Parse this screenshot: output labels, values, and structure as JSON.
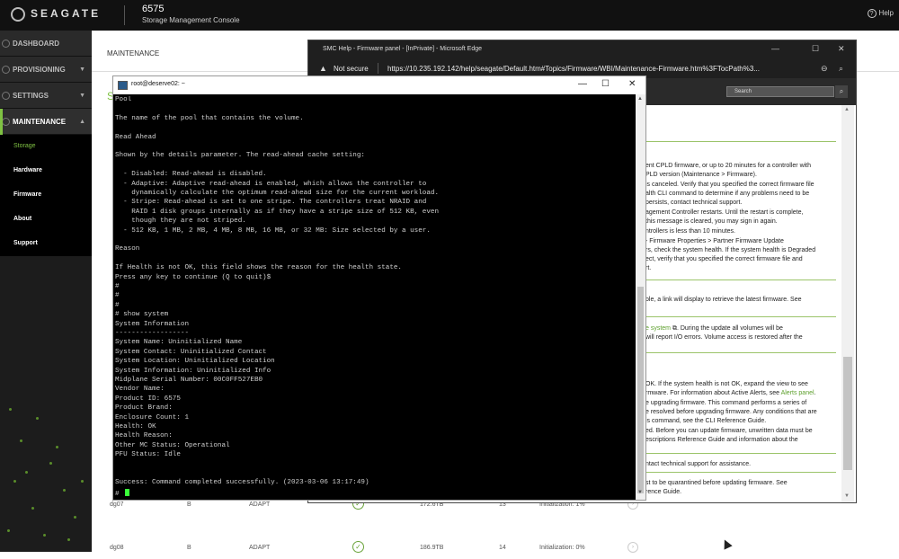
{
  "topbar": {
    "logo": "SEAGATE",
    "product": "6575",
    "subtitle": "Storage Management Console",
    "help": "Help"
  },
  "sidebar": {
    "items": [
      {
        "label": "DASHBOARD"
      },
      {
        "label": "PROVISIONING"
      },
      {
        "label": "SETTINGS"
      },
      {
        "label": "MAINTENANCE"
      }
    ],
    "subitems": [
      {
        "label": "Storage"
      },
      {
        "label": "Hardware"
      },
      {
        "label": "Firmware"
      },
      {
        "label": "About"
      },
      {
        "label": "Support"
      }
    ]
  },
  "main": {
    "title": "MAINTENANCE",
    "section_initial": "S",
    "rows": [
      {
        "name": "dg07",
        "owner": "B",
        "type": "ADAPT",
        "size": "172.6TB",
        "disks": "13",
        "status": "Initialization: 1%"
      },
      {
        "name": "dg08",
        "owner": "B",
        "type": "ADAPT",
        "size": "186.9TB",
        "disks": "14",
        "status": "Initialization: 0%"
      }
    ]
  },
  "edge": {
    "title": "SMC Help - Firmware panel - [InPrivate] - Microsoft Edge",
    "not_secure": "Not secure",
    "url": "https://10.235.192.142/help/seagate/Default.htm#Topics/Firmware/WBI/Maintenance-Firmware.htm%3FTocPath%3...",
    "search_placeholder": "Search",
    "paragraphs": [
      "ent CPLD firmware, or up to 20 minutes for a controller with",
      "PLD version (Maintenance > Firmware).",
      "is canceled. Verify that you specified the correct firmware file",
      "alth CLI command to determine if any problems need to be",
      "persists, contact technical support.",
      "agement Controller restarts. Until the restart is complete,",
      "this message is cleared, you may sign in again.",
      "ntrollers is less than 10 minutes.",
      "- Firmware Properties > Partner Firmware Update",
      "rs, check the system health. If the system health is Degraded",
      "ect, verify that you specified the correct firmware file and",
      "rt.",
      "ble, a link will display to retrieve the latest firmware. See",
      "e system",
      ". During the update all volumes will be",
      "will report I/O errors. Volume access is restored after the",
      "OK. If the system health is not OK, expand the view to see",
      "rmware. For information about Active Alerts, see",
      "Alerts panel",
      "e upgrading firmware. This command performs a series of",
      "e resolved before upgrading firmware. Any conditions that are",
      "is command, see the CLI Reference Guide.",
      "ed. Before you can update firmware, unwritten data must be",
      "escriptions Reference Guide and information about the",
      "ntact technical support for assistance.",
      "st to be quarantined before updating firmware. See",
      "rence Guide."
    ]
  },
  "terminal": {
    "title": "root@deserve02: ~",
    "lines": [
      "Pool",
      "",
      "The name of the pool that contains the volume.",
      "",
      "Read Ahead",
      "",
      "Shown by the details parameter. The read-ahead cache setting:",
      "",
      "  - Disabled: Read-ahead is disabled.",
      "  - Adaptive: Adaptive read-ahead is enabled, which allows the controller to",
      "    dynamically calculate the optimum read-ahead size for the current workload.",
      "  - Stripe: Read-ahead is set to one stripe. The controllers treat NRAID and",
      "    RAID 1 disk groups internally as if they have a stripe size of 512 KB, even",
      "    though they are not striped.",
      "  - 512 KB, 1 MB, 2 MB, 4 MB, 8 MB, 16 MB, or 32 MB: Size selected by a user.",
      "",
      "Reason",
      "",
      "If Health is not OK, this field shows the reason for the health state.",
      "Press any key to continue (Q to quit)$",
      "#",
      "#",
      "#",
      "# show system",
      "System Information",
      "------------------",
      "System Name: Uninitialized Name",
      "System Contact: Uninitialized Contact",
      "System Location: Uninitialized Location",
      "System Information: Uninitialized Info",
      "Midplane Serial Number: 00C0FF527EB0",
      "Vendor Name:",
      "Product ID: 6575",
      "Product Brand:",
      "Enclosure Count: 1",
      "Health: OK",
      "Health Reason:",
      "Other MC Status: Operational",
      "PFU Status: Idle",
      "",
      "",
      "Success: Command completed successfully. (2023-03-06 13:17:49)",
      "#"
    ]
  },
  "colors": {
    "accent": "#7fc243",
    "terminal_bg": "#000000",
    "terminal_text": "#cfcfcf"
  }
}
